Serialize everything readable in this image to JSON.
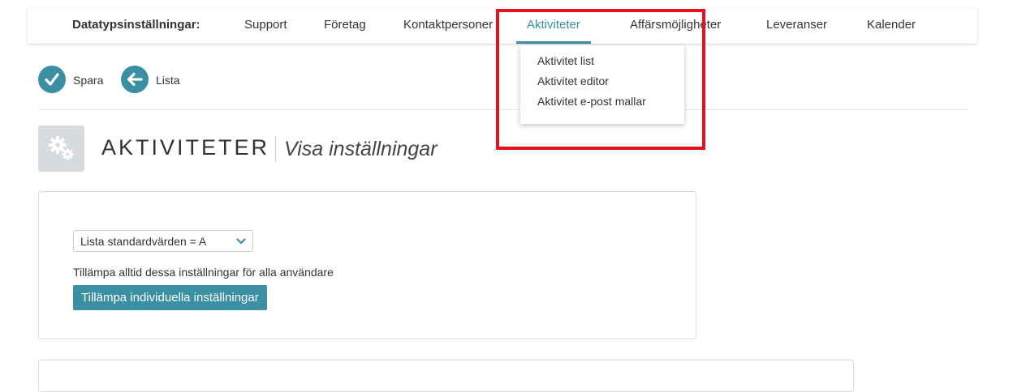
{
  "nav": {
    "label": "Datatypsinställningar:",
    "items": [
      {
        "label": "Support"
      },
      {
        "label": "Företag"
      },
      {
        "label": "Kontaktpersoner"
      },
      {
        "label": "Aktiviteter"
      },
      {
        "label": "Affärsmöjligheter"
      },
      {
        "label": "Leveranser"
      },
      {
        "label": "Kalender"
      }
    ],
    "active": "Aktiviteter"
  },
  "dropdown": {
    "items": [
      {
        "label": "Aktivitet list"
      },
      {
        "label": "Aktivitet editor"
      },
      {
        "label": "Aktivitet e-post mallar"
      }
    ]
  },
  "toolbar": {
    "save_label": "Spara",
    "list_label": "Lista",
    "save_icon": "check-icon",
    "list_icon": "arrow-left-icon"
  },
  "page": {
    "title": "AKTIVITETER",
    "subtitle": "Visa inställningar",
    "icon": "gears-icon"
  },
  "settings": {
    "select_value": "Lista standardvärden = A",
    "info_text": "Tillämpa alltid dessa inställningar för alla användare",
    "apply_button": "Tillämpa individuella inställningar"
  },
  "colors": {
    "accent": "#3a8fa3",
    "highlight": "#e8101a"
  }
}
